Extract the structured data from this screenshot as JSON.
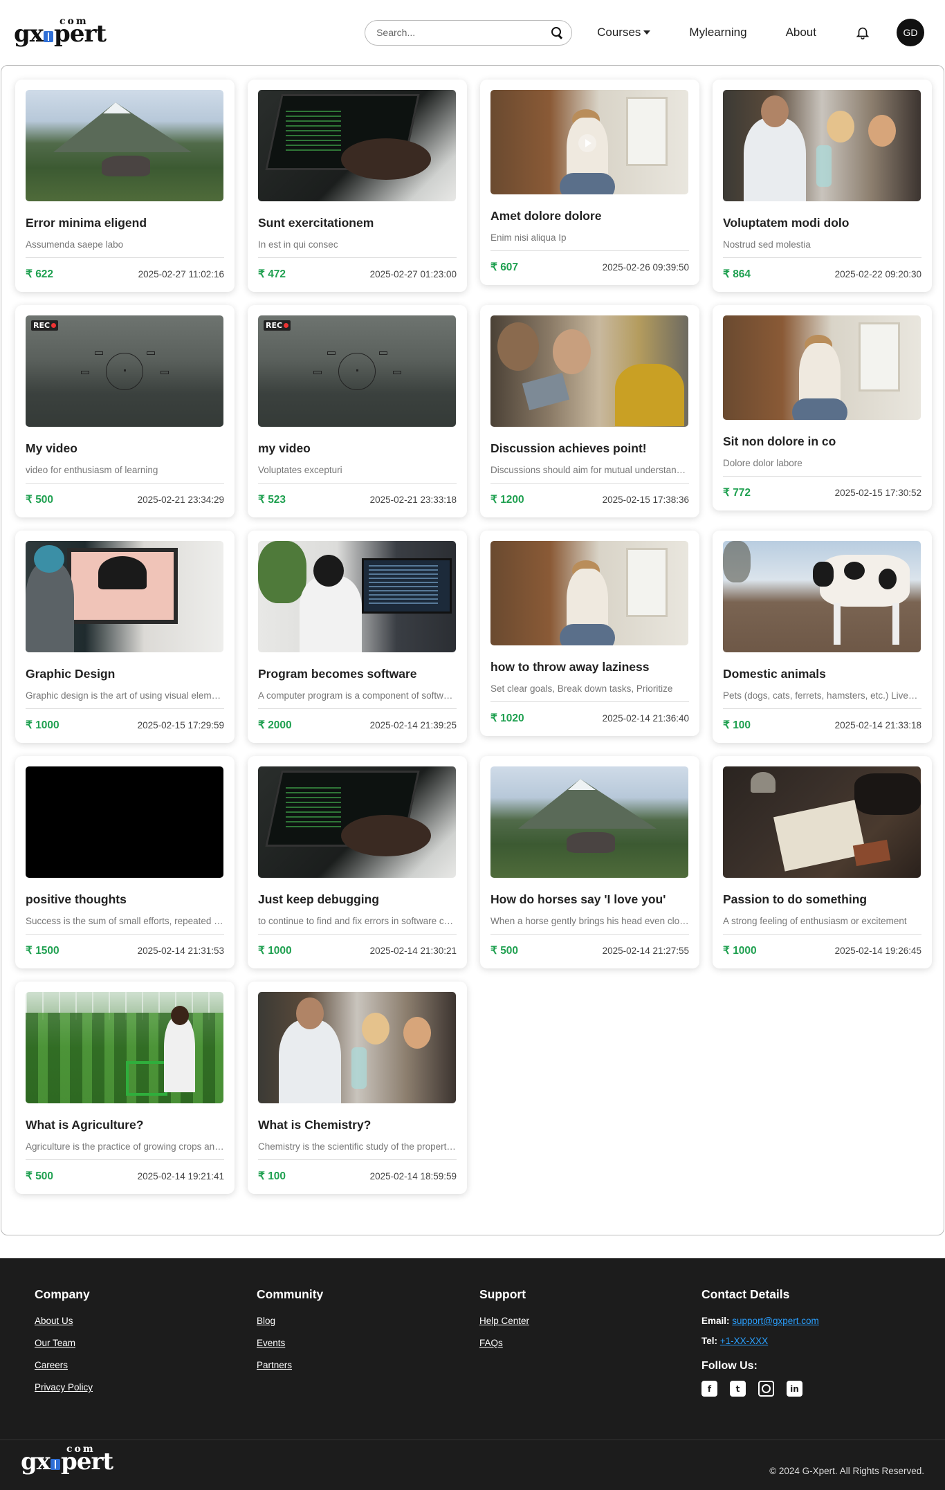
{
  "header": {
    "logo_text_left": "gx",
    "logo_text_right": "pert",
    "logo_com": "com",
    "search_placeholder": "Search...",
    "nav": {
      "courses": "Courses",
      "mylearning": "Mylearning",
      "about": "About"
    },
    "avatar_initials": "GD"
  },
  "currency": "₹",
  "courses": [
    {
      "title": "Error minima eligend",
      "desc": "Assumenda saepe labo",
      "price": "622",
      "date": "2025-02-27 11:02:16",
      "thumb": "mountain"
    },
    {
      "title": "Sunt exercitationem",
      "desc": "In est in qui consec",
      "price": "472",
      "date": "2025-02-27 01:23:00",
      "thumb": "laptop"
    },
    {
      "title": "Amet dolore dolore",
      "desc": "Enim nisi aliqua Ip",
      "price": "607",
      "date": "2025-02-26 09:39:50",
      "thumb": "room-play"
    },
    {
      "title": "Voluptatem modi dolo",
      "desc": "Nostrud sed molestia",
      "price": "864",
      "date": "2025-02-22 09:20:30",
      "thumb": "lab"
    },
    {
      "title": "My video",
      "desc": "video for enthusiasm of learning",
      "price": "500",
      "date": "2025-02-21 23:34:29",
      "thumb": "rec"
    },
    {
      "title": "my video",
      "desc": "Voluptates excepturi",
      "price": "523",
      "date": "2025-02-21 23:33:18",
      "thumb": "rec"
    },
    {
      "title": "Discussion achieves point!",
      "desc": "Discussions should aim for mutual understanding",
      "price": "1200",
      "date": "2025-02-15 17:38:36",
      "thumb": "group"
    },
    {
      "title": "Sit non dolore in co",
      "desc": "Dolore dolor labore",
      "price": "772",
      "date": "2025-02-15 17:30:52",
      "thumb": "room"
    },
    {
      "title": "Graphic Design",
      "desc": "Graphic design is the art of using visual elements",
      "price": "1000",
      "date": "2025-02-15 17:29:59",
      "thumb": "design"
    },
    {
      "title": "Program becomes software",
      "desc": "A computer program is a component of software",
      "price": "2000",
      "date": "2025-02-14 21:39:25",
      "thumb": "program"
    },
    {
      "title": "how to throw away laziness",
      "desc": "Set clear goals, Break down tasks, Prioritize",
      "price": "1020",
      "date": "2025-02-14 21:36:40",
      "thumb": "room"
    },
    {
      "title": "Domestic animals",
      "desc": "Pets (dogs, cats, ferrets, hamsters, etc.) Livestock",
      "price": "100",
      "date": "2025-02-14 21:33:18",
      "thumb": "cow"
    },
    {
      "title": "positive thoughts",
      "desc": "Success is the sum of small efforts, repeated day in and day out",
      "price": "1500",
      "date": "2025-02-14 21:31:53",
      "thumb": "black"
    },
    {
      "title": "Just keep debugging",
      "desc": "to continue to find and fix errors in software code",
      "price": "1000",
      "date": "2025-02-14 21:30:21",
      "thumb": "laptop"
    },
    {
      "title": "How do horses say 'I love you'",
      "desc": "When a horse gently brings his head even closer",
      "price": "500",
      "date": "2025-02-14 21:27:55",
      "thumb": "mountain"
    },
    {
      "title": "Passion to do something",
      "desc": "A strong feeling of enthusiasm or excitement",
      "price": "1000",
      "date": "2025-02-14 19:26:45",
      "thumb": "book"
    },
    {
      "title": "What is Agriculture?",
      "desc": "Agriculture is the practice of growing crops and raising livestock",
      "price": "500",
      "date": "2025-02-14 19:21:41",
      "thumb": "agri"
    },
    {
      "title": "What is Chemistry?",
      "desc": "Chemistry is the scientific study of the properties of matter",
      "price": "100",
      "date": "2025-02-14 18:59:59",
      "thumb": "lab"
    }
  ],
  "footer": {
    "company": {
      "heading": "Company",
      "links": [
        "About Us",
        "Our Team",
        "Careers",
        "Privacy Policy"
      ]
    },
    "community": {
      "heading": "Community",
      "links": [
        "Blog",
        "Events",
        "Partners"
      ]
    },
    "support": {
      "heading": "Support",
      "links": [
        "Help Center",
        "FAQs"
      ]
    },
    "contact": {
      "heading": "Contact Details",
      "email_label": "Email:",
      "email": "support@gxpert.com",
      "tel_label": "Tel:",
      "tel": "+1-XX-XXX",
      "follow": "Follow Us:"
    },
    "copyright": "© 2024 G-Xpert. All Rights Reserved."
  }
}
